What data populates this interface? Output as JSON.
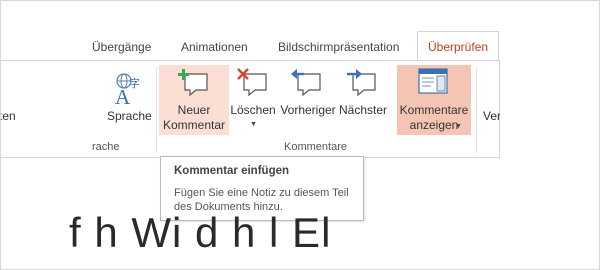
{
  "tabs": [
    {
      "label": "Übergänge"
    },
    {
      "label": "Animationen"
    },
    {
      "label": "Bildschirmpräsentation"
    },
    {
      "label": "Überprüfen",
      "active": true
    }
  ],
  "ribbon": {
    "groups": {
      "language": {
        "label": "rache",
        "partial_button_label": "ten",
        "sprache_label": "Sprache",
        "sprache_icon": "translate-icon"
      },
      "comments": {
        "label": "Kommentare",
        "new_comment": {
          "line1": "Neuer",
          "line2": "Kommentar",
          "icon": "new-comment-icon"
        },
        "delete": {
          "label": "Löschen",
          "icon": "delete-comment-icon"
        },
        "previous": {
          "label": "Vorheriger",
          "icon": "previous-comment-icon"
        },
        "next": {
          "label": "Nächster",
          "icon": "next-comment-icon"
        },
        "show_comments": {
          "line1": "Kommentare",
          "line2": "anzeigen",
          "icon": "show-comments-pane-icon"
        }
      },
      "compare": {
        "partial_label": "Ver"
      }
    }
  },
  "tooltip": {
    "title": "Kommentar einfügen",
    "body": "Fügen Sie eine Notiz zu diesem Teil des Dokuments hinzu."
  },
  "slide": {
    "partial_text": "f     h      Wi     d    h l      El"
  },
  "colors": {
    "active_tab": "#c43e1c",
    "hover_highlight": "#fbdfd4",
    "pressed_highlight": "#f5c5b3",
    "comment_add_green": "#3aa657",
    "comment_delete_red": "#d9452b",
    "nav_arrow_blue": "#3b6fb6"
  }
}
